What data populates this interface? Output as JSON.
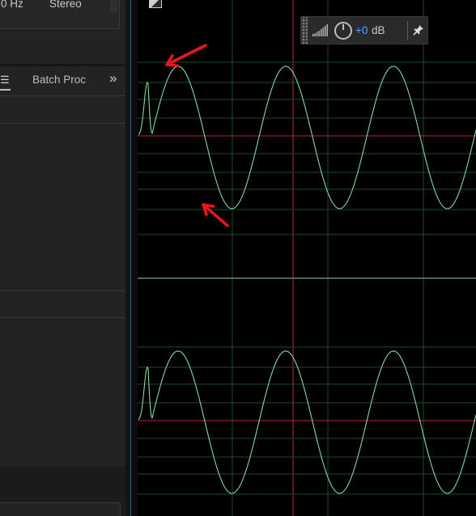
{
  "files_panel": {
    "sample_rate_partial": "0 Hz",
    "channels": "Stereo"
  },
  "tabs": {
    "active_icon": "menu-lines-icon",
    "batch_label": "Batch Proc",
    "overflow_icon": "double-chevron-right-icon"
  },
  "hud": {
    "level_icon": "level-meter-icon",
    "knob_icon": "volume-knob-icon",
    "gain_value": "+0",
    "gain_unit": "dB",
    "pin_icon": "pin-icon"
  },
  "waveform": {
    "wave_color": "#7fd9a3",
    "grid_color": "#1e4a28",
    "center_line_color": "#b82a3a",
    "channel_divider_color": "#6aa876"
  },
  "annotations": {
    "arrow_color": "#e8161e",
    "arrow_icon": "red-arrow-icon"
  }
}
